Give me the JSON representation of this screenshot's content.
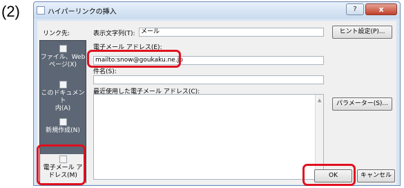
{
  "step_label": "(2)",
  "window": {
    "title": "ハイパーリンクの挿入",
    "help_button": "?",
    "close_button": "x"
  },
  "link_to_label": "リンク先:",
  "sidebar": {
    "items": [
      {
        "label": "ファイル、Web ページ(X)",
        "line1": "ファイル、Web",
        "line2": "ページ(X)",
        "icon": "web-page-icon"
      },
      {
        "label": "このドキュメント内(A)",
        "line1": "このドキュメント",
        "line2": "内(A)",
        "icon": "document-icon"
      },
      {
        "label": "新規作成(N)",
        "line1": "新規作成(N)",
        "line2": "",
        "icon": "new-document-icon"
      },
      {
        "label": "電子メール アドレス(M)",
        "line1": "電子メール ア",
        "line2": "ドレス(M)",
        "icon": "email-icon"
      }
    ]
  },
  "form": {
    "display_text_label": "表示文字列(T):",
    "display_text_value": "メール",
    "email_address_label": "電子メール アドレス(E):",
    "email_address_value": "mailto:snow@goukaku.ne.jp",
    "subject_label": "件名(S):",
    "subject_value": "",
    "recent_label": "最近使用した電子メール アドレス(C):"
  },
  "buttons": {
    "screentip": "ヒント設定(P)...",
    "parameters": "パラメーター(S)...",
    "ok": "OK",
    "cancel": "キャンセル"
  },
  "highlight_color": "#e0101e"
}
